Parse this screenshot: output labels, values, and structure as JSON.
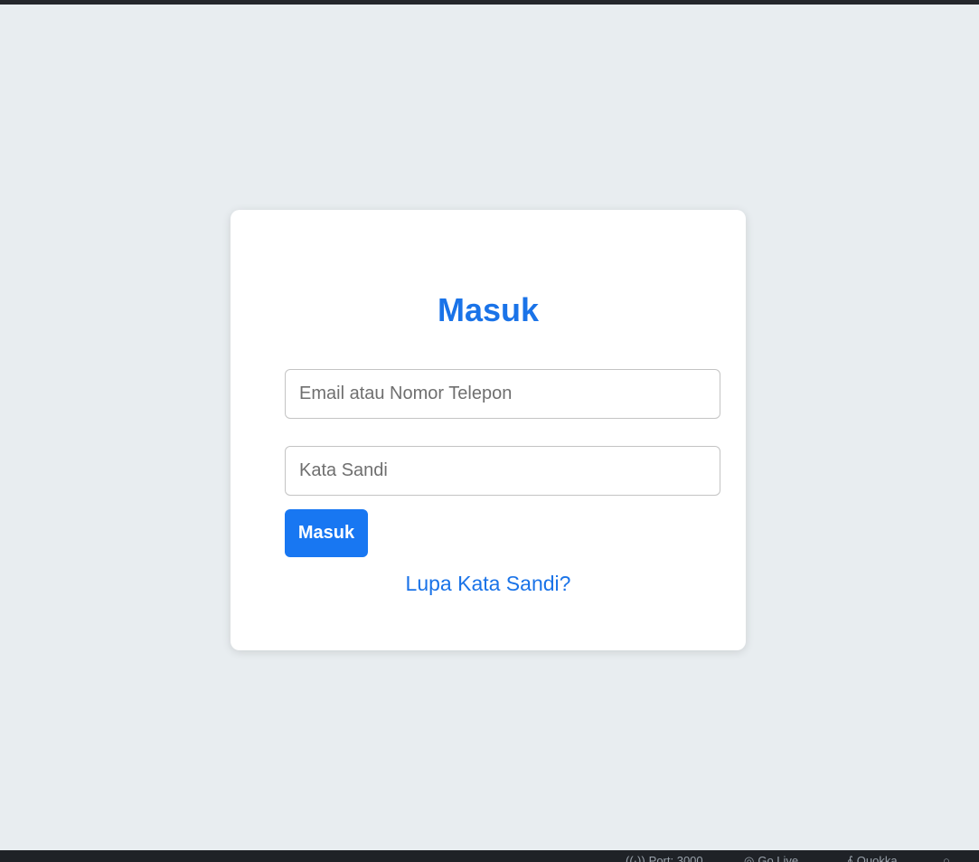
{
  "login": {
    "title": "Masuk",
    "email_placeholder": "Email atau Nomor Telepon",
    "password_placeholder": "Kata Sandi",
    "submit_label": "Masuk",
    "forgot_label": "Lupa Kata Sandi?"
  },
  "status_bar": {
    "items": [
      {
        "icon": "broadcast-icon",
        "label": "Port: 3000"
      },
      {
        "icon": "circle-icon",
        "label": "Go Live"
      },
      {
        "icon": "bell-icon",
        "label": "Quokka"
      },
      {
        "icon": "search-icon",
        "label": ""
      }
    ]
  },
  "colors": {
    "accent": "#1a73e8",
    "button": "#1877f2",
    "background": "#e8edf0",
    "status_bar": "#1f2227"
  }
}
